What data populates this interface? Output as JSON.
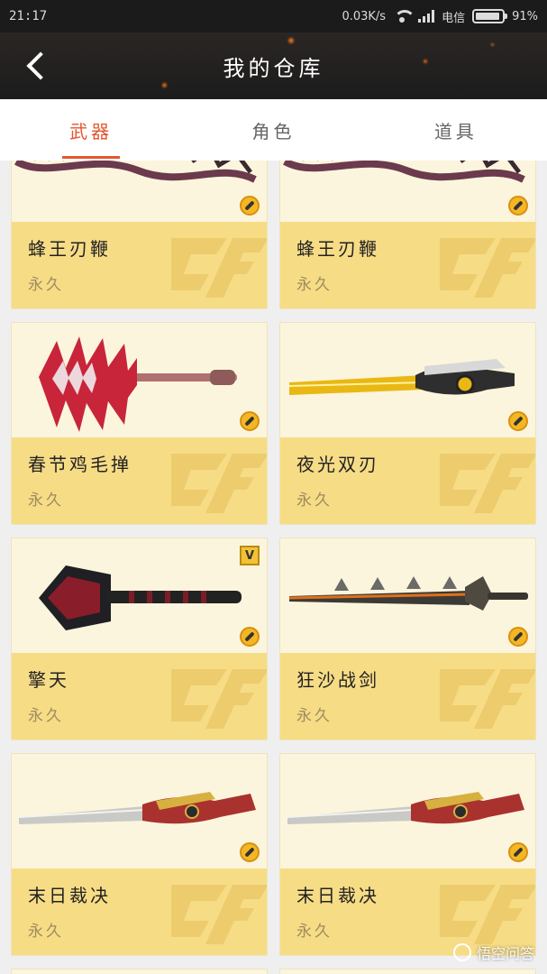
{
  "status": {
    "time": "21:17",
    "speed": "0.03K/s",
    "network": "4G",
    "carrier": "电信",
    "battery": "91%"
  },
  "header": {
    "title": "我的仓库"
  },
  "tabs": [
    {
      "label": "武器",
      "active": true
    },
    {
      "label": "角色",
      "active": false
    },
    {
      "label": "道具",
      "active": false
    }
  ],
  "items": [
    {
      "name": "蜂王刃鞭",
      "duration": "永久",
      "weapon": "whip",
      "badge": "coin"
    },
    {
      "name": "蜂王刃鞭",
      "duration": "永久",
      "weapon": "whip",
      "badge": "coin"
    },
    {
      "name": "春节鸡毛掸",
      "duration": "永久",
      "weapon": "duster",
      "badge": "coin"
    },
    {
      "name": "夜光双刃",
      "duration": "永久",
      "weapon": "blade",
      "badge": "coin"
    },
    {
      "name": "擎天",
      "duration": "永久",
      "weapon": "shovel",
      "badge": "coin",
      "vip": "V"
    },
    {
      "name": "狂沙战剑",
      "duration": "永久",
      "weapon": "sword",
      "badge": "coin"
    },
    {
      "name": "末日裁决",
      "duration": "永久",
      "weapon": "longsword",
      "badge": "coin"
    },
    {
      "name": "末日裁决",
      "duration": "永久",
      "weapon": "longsword",
      "badge": "coin"
    }
  ],
  "watermark": {
    "text": "悟空问答"
  },
  "colors": {
    "accent": "#e4572e",
    "card_top": "#fcf5dd",
    "card_bottom": "#f7dc86",
    "header": "#1c1c1c"
  }
}
